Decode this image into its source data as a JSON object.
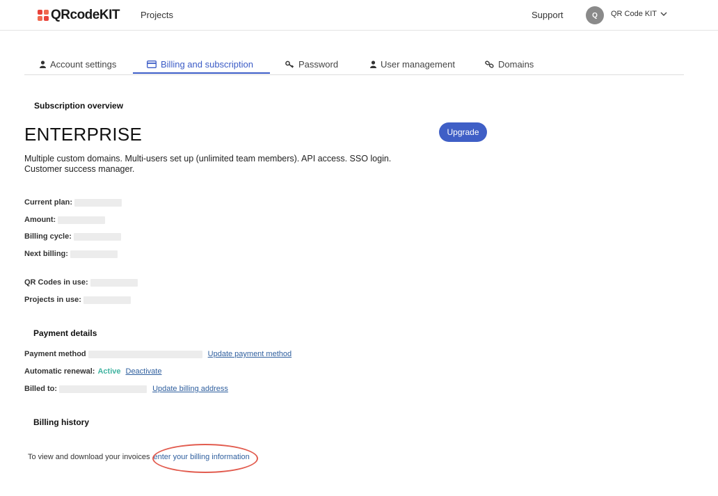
{
  "header": {
    "logo_text": "QRcodeKIT",
    "nav_projects": "Projects",
    "nav_support": "Support",
    "avatar_initial": "Q",
    "account_name": "QR Code KIT"
  },
  "tabs": [
    {
      "label": "Account settings",
      "icon": "user-icon",
      "active": false
    },
    {
      "label": "Billing and subscription",
      "icon": "credit-card-icon",
      "active": true
    },
    {
      "label": "Password",
      "icon": "key-icon",
      "active": false
    },
    {
      "label": "User management",
      "icon": "user-icon",
      "active": false
    },
    {
      "label": "Domains",
      "icon": "link-icon",
      "active": false
    }
  ],
  "subscription": {
    "heading": "Subscription overview",
    "plan_name": "ENTERPRISE",
    "plan_description": "Multiple custom domains. Multi-users set up (unlimited team members). API access. SSO login. Customer success manager.",
    "upgrade_label": "Upgrade",
    "fields": {
      "current_plan": "Current plan:",
      "amount": "Amount:",
      "billing_cycle": "Billing cycle:",
      "next_billing": "Next billing:",
      "qr_codes": "QR Codes in use:",
      "projects": "Projects in use:"
    }
  },
  "payment": {
    "heading": "Payment details",
    "method_label": "Payment method",
    "update_method": "Update payment method",
    "renewal_label": "Automatic renewal:",
    "renewal_status": "Active",
    "deactivate": "Deactivate",
    "billed_to_label": "Billed to:",
    "update_address": "Update billing address"
  },
  "history": {
    "heading": "Billing history",
    "text": "To view and download your invoices",
    "link": "enter your billing information"
  },
  "colors": {
    "accent": "#3b5bc6",
    "active_status": "#3fb3a0",
    "link": "#2f5f9e",
    "annotation": "#e25c4f"
  }
}
